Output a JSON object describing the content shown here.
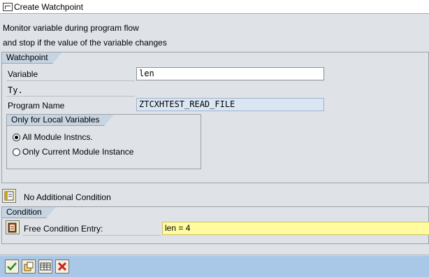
{
  "window": {
    "title": "Create Watchpoint"
  },
  "description": {
    "line1": "Monitor variable during program flow",
    "line2": "and stop if the value of the variable changes"
  },
  "watchpoint": {
    "title": "Watchpoint",
    "variable_label": "Variable",
    "variable_value": "len",
    "type_label": "Ty.",
    "program_label": "Program Name",
    "program_value": "ZTCXHTEST_READ_FILE"
  },
  "local_vars": {
    "title": "Only for Local Variables",
    "options": [
      {
        "label": "All Module Instncs.",
        "selected": true
      },
      {
        "label": "Only Current Module Instance",
        "selected": false
      }
    ]
  },
  "additional": {
    "label": "No Additional Condition",
    "icon": "condition-icon"
  },
  "condition": {
    "title": "Condition",
    "label": "Free Condition Entry:",
    "value": "len = 4",
    "icon": "book-edit-icon"
  },
  "toolbar": {
    "buttons": [
      {
        "name": "confirm-button",
        "icon": "check-icon",
        "color": "#2a8a1f"
      },
      {
        "name": "new-button",
        "icon": "new-entry-icon",
        "color": "#6b4c10"
      },
      {
        "name": "layout-button",
        "icon": "layout-icon",
        "color": "#333333"
      },
      {
        "name": "cancel-button",
        "icon": "x-icon",
        "color": "#d02020"
      }
    ]
  },
  "colors": {
    "background": "#dfe3e8",
    "group_tab": "#c7d5e3",
    "footer": "#a9c7e6",
    "condition_input": "#fffb9e"
  }
}
